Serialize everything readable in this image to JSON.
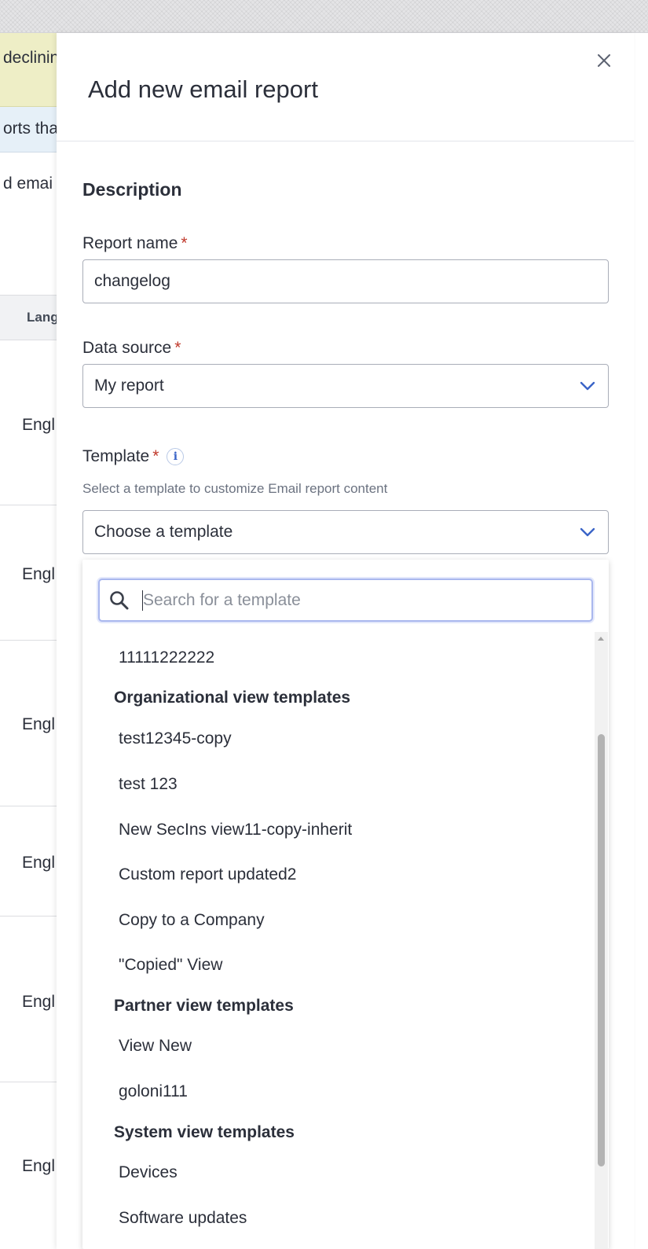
{
  "background": {
    "alert_text": "declinin",
    "info_text": "orts tha",
    "body_text": "d emai",
    "table_header": "Lang",
    "row_language": "Engl"
  },
  "drawer": {
    "title": "Add new email report",
    "section_title": "Description",
    "report_name": {
      "label": "Report name",
      "required": "*",
      "value": "changelog"
    },
    "data_source": {
      "label": "Data source",
      "required": "*",
      "value": "My report"
    },
    "template": {
      "label": "Template",
      "required": "*",
      "info_icon": "i",
      "help": "Select a template to customize Email report content",
      "value": "Choose a template"
    }
  },
  "dropdown": {
    "search_placeholder": "Search for a template",
    "items": [
      {
        "type": "option",
        "label": "11111222222"
      },
      {
        "type": "group",
        "label": "Organizational view templates"
      },
      {
        "type": "option",
        "label": "test12345-copy"
      },
      {
        "type": "option",
        "label": "test 123"
      },
      {
        "type": "option",
        "label": "New SecIns view11-copy-inherit"
      },
      {
        "type": "option",
        "label": "Custom report updated2"
      },
      {
        "type": "option",
        "label": "Copy to a Company"
      },
      {
        "type": "option",
        "label": "\"Copied\" View"
      },
      {
        "type": "group",
        "label": "Partner view templates"
      },
      {
        "type": "option",
        "label": "View New"
      },
      {
        "type": "option",
        "label": "goloni111"
      },
      {
        "type": "group",
        "label": "System view templates"
      },
      {
        "type": "option",
        "label": "Devices"
      },
      {
        "type": "option",
        "label": "Software updates"
      }
    ]
  },
  "colors": {
    "accent": "#3a64c7",
    "required": "#c0392b",
    "alert_bg": "#eeeec6",
    "info_bg": "#e6f0f8"
  }
}
